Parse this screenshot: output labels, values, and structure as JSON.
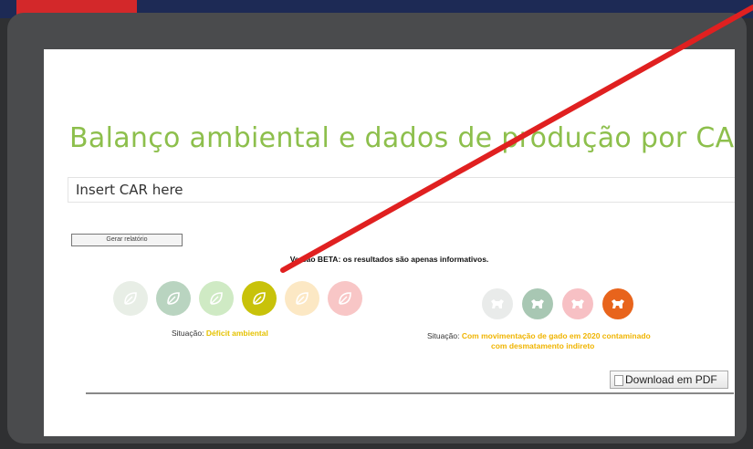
{
  "page": {
    "title": "Balanço ambiental e dados de produção por CAR:",
    "car_input": {
      "placeholder": "Insert CAR here",
      "value": ""
    },
    "generate_button": "Gerar relatório",
    "beta_notice": "Versão BETA: os resultados são apenas informativos.",
    "left_status": {
      "label": "Situação: ",
      "value": "Déficit ambiental"
    },
    "right_status": {
      "label": "Situação: ",
      "value_line1": "Com movimentação de gado em 2020 contaminado",
      "value_line2": "com desmatamento indireto"
    },
    "download_button": "Download em PDF"
  },
  "icons": {
    "environmental": [
      {
        "name": "leaf-icon",
        "color": "#e8eee6",
        "active": false
      },
      {
        "name": "leaf-icon",
        "color": "#b9d4c0",
        "active": false
      },
      {
        "name": "leaf-icon",
        "color": "#cfeac4",
        "active": false
      },
      {
        "name": "leaf-icon",
        "color": "#c8c20a",
        "active": true
      },
      {
        "name": "leaf-icon",
        "color": "#fce8c4",
        "active": false
      },
      {
        "name": "leaf-icon",
        "color": "#f8c6c6",
        "active": false
      }
    ],
    "cattle": [
      {
        "name": "cattle-icon",
        "color": "#e9ebea",
        "active": false
      },
      {
        "name": "cattle-icon",
        "color": "#a8c7b3",
        "active": false
      },
      {
        "name": "cattle-icon",
        "color": "#f7c0c4",
        "active": false
      },
      {
        "name": "cattle-icon",
        "color": "#e8641c",
        "active": true
      }
    ]
  },
  "colors": {
    "title": "#8dbf4c",
    "status_yellow": "#e5c200",
    "status_orange": "#f0b400",
    "annotation_arrow": "#e02020"
  }
}
